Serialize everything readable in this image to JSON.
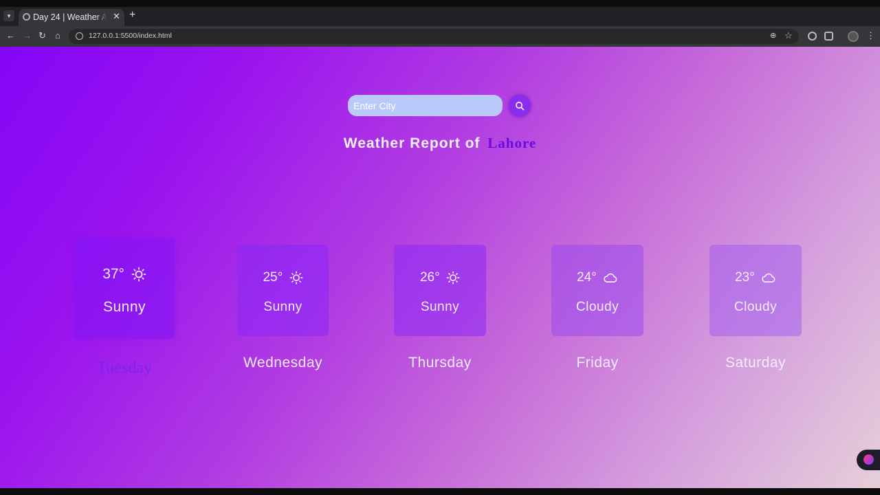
{
  "browser": {
    "tab_title": "Day 24 | Weather A",
    "url": "127.0.0.1:5500/index.html"
  },
  "search": {
    "placeholder": "Enter City",
    "value": ""
  },
  "header": {
    "prefix": "Weather Report of",
    "city": "Lahore"
  },
  "forecast": [
    {
      "day": "Tuesday",
      "temp": "37°",
      "condition": "Sunny",
      "icon": "sun-icon"
    },
    {
      "day": "Wednesday",
      "temp": "25°",
      "condition": "Sunny",
      "icon": "sun-icon"
    },
    {
      "day": "Thursday",
      "temp": "26°",
      "condition": "Sunny",
      "icon": "sun-icon"
    },
    {
      "day": "Friday",
      "temp": "24°",
      "condition": "Cloudy",
      "icon": "cloud-icon"
    },
    {
      "day": "Saturday",
      "temp": "23°",
      "condition": "Cloudy",
      "icon": "cloud-icon"
    }
  ],
  "colors": {
    "gradient_start": "#8406f7",
    "gradient_end": "#e6cfd9",
    "city_accent": "#6a0ae6",
    "input_bg": "#b9c9fa"
  }
}
